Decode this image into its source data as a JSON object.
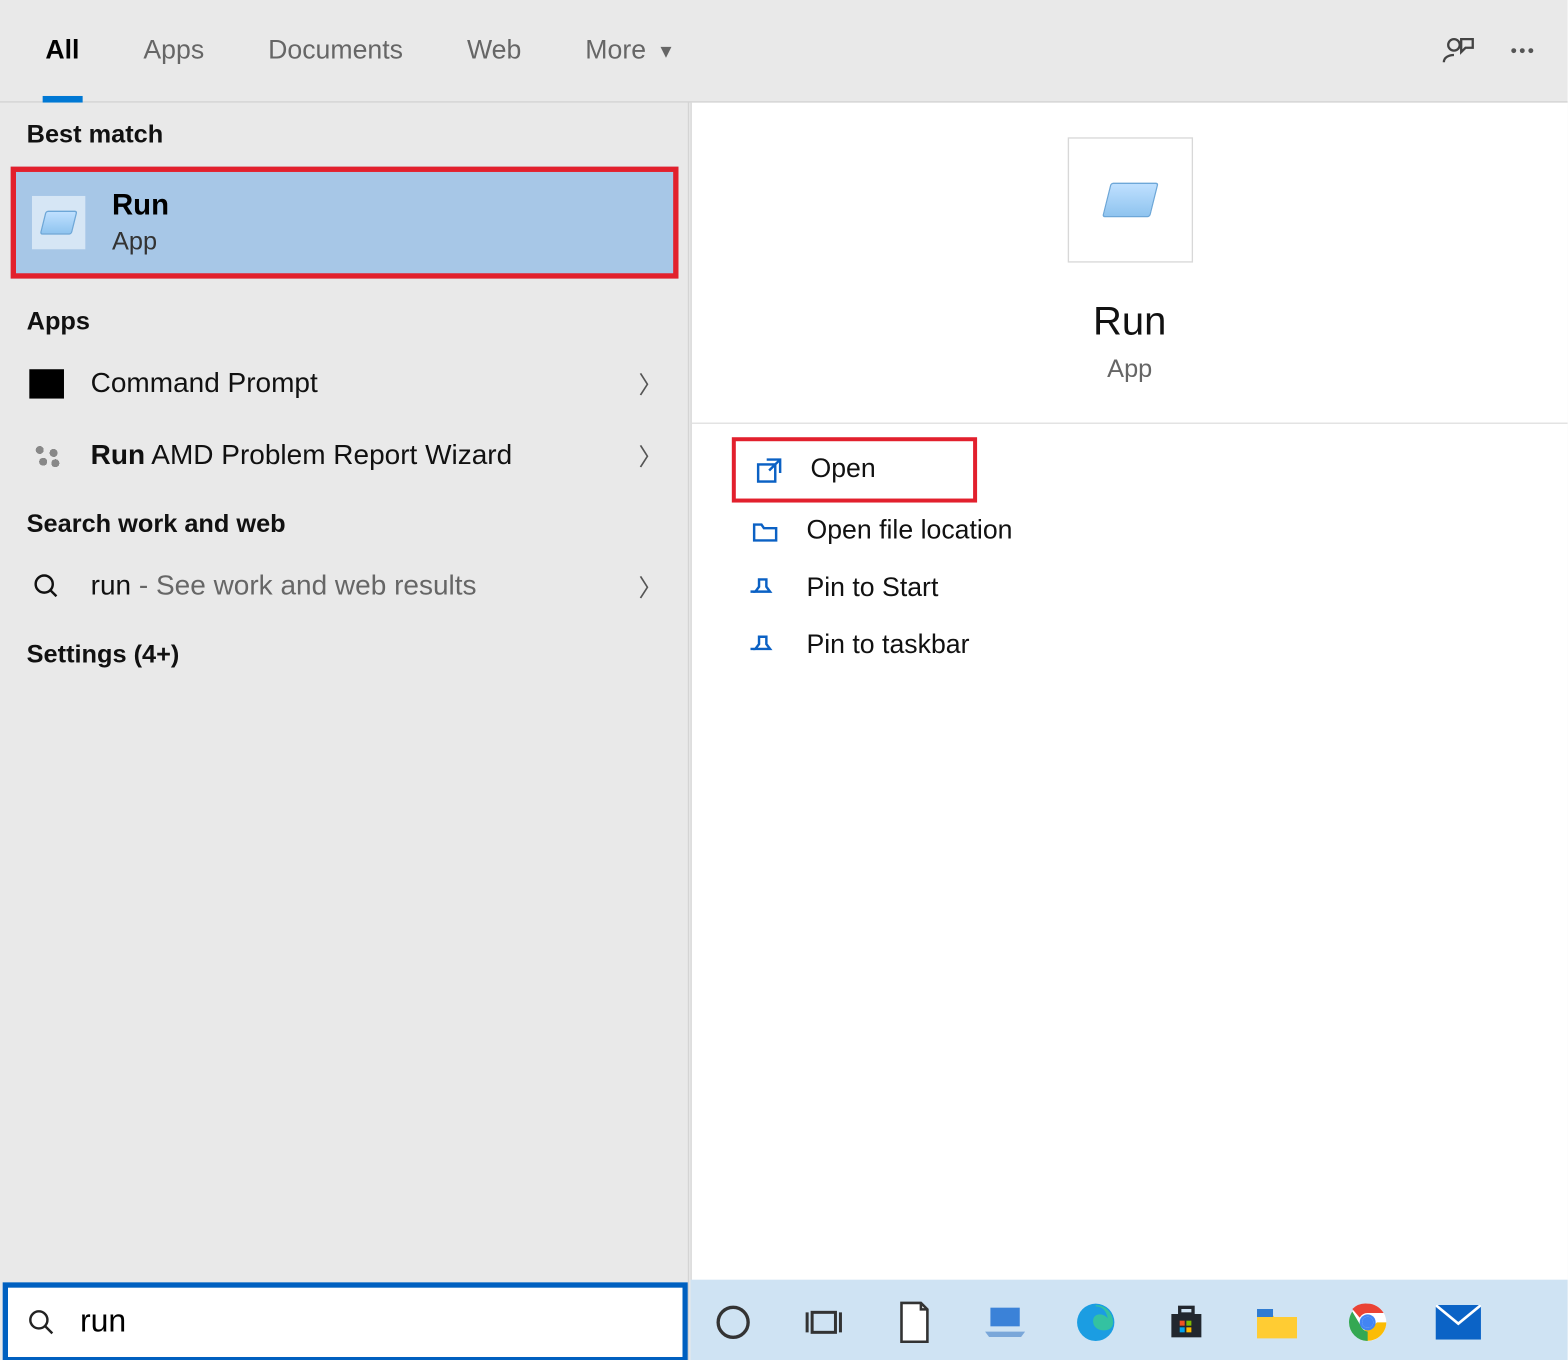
{
  "tabs": {
    "all": "All",
    "apps": "Apps",
    "documents": "Documents",
    "web": "Web",
    "more": "More"
  },
  "sections": {
    "best_match": "Best match",
    "apps": "Apps",
    "search_ww": "Search work and web",
    "settings": "Settings (4+)"
  },
  "best": {
    "title": "Run",
    "subtitle": "App"
  },
  "apps_list": {
    "cmd": "Command Prompt",
    "amd_prefix": "Run",
    "amd_rest": " AMD Problem Report Wizard"
  },
  "web_row": {
    "query": "run",
    "suffix": " - See work and web results"
  },
  "preview": {
    "title": "Run",
    "subtitle": "App"
  },
  "actions": {
    "open": "Open",
    "open_loc": "Open file location",
    "pin_start": "Pin to Start",
    "pin_taskbar": "Pin to taskbar"
  },
  "search": {
    "value": "run"
  }
}
